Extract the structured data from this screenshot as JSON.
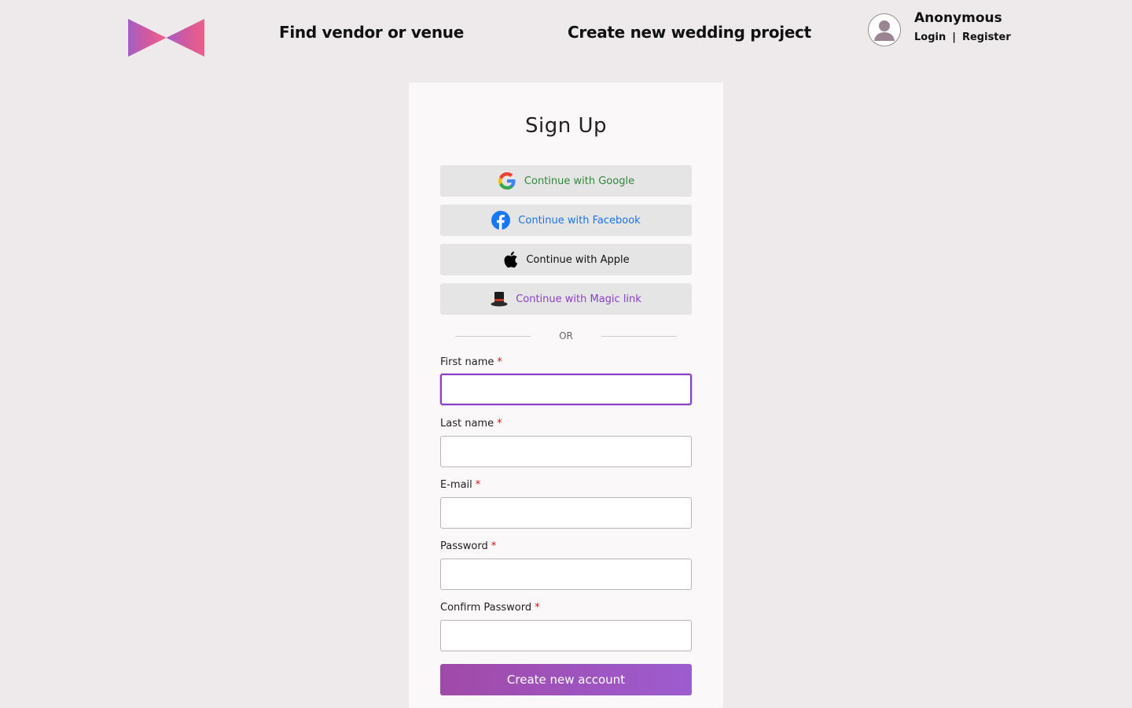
{
  "header": {
    "nav_find": "Find vendor or venue",
    "nav_create": "Create new wedding project",
    "user_name": "Anonymous",
    "login_label": "Login",
    "separator": "|",
    "register_label": "Register"
  },
  "signup": {
    "title": "Sign Up",
    "google_label": "Continue with Google",
    "facebook_label": "Continue with Facebook",
    "apple_label": "Continue with Apple",
    "magic_label": "Continue with Magic link",
    "or_label": "OR",
    "required_mark": "*",
    "fields": [
      {
        "label": "First name",
        "value": ""
      },
      {
        "label": "Last name",
        "value": ""
      },
      {
        "label": "E-mail",
        "value": ""
      },
      {
        "label": "Password",
        "value": ""
      },
      {
        "label": "Confirm Password",
        "value": ""
      }
    ],
    "submit_label": "Create new account"
  },
  "icons": {
    "logo": "bowtie-logo",
    "avatar": "user-avatar-icon",
    "google": "google-icon",
    "facebook": "facebook-icon",
    "apple": "apple-icon",
    "magic": "top-hat-icon"
  },
  "colors": {
    "background": "#eeeaeb",
    "card": "#faf8f9",
    "google_text": "#2f8a3a",
    "facebook_text": "#1a73e8",
    "magic_text": "#8a3fc7",
    "focus_border": "#8a3fc7",
    "required": "#dd1111",
    "submit_start": "#a04aa8",
    "submit_end": "#9d5ccf"
  }
}
